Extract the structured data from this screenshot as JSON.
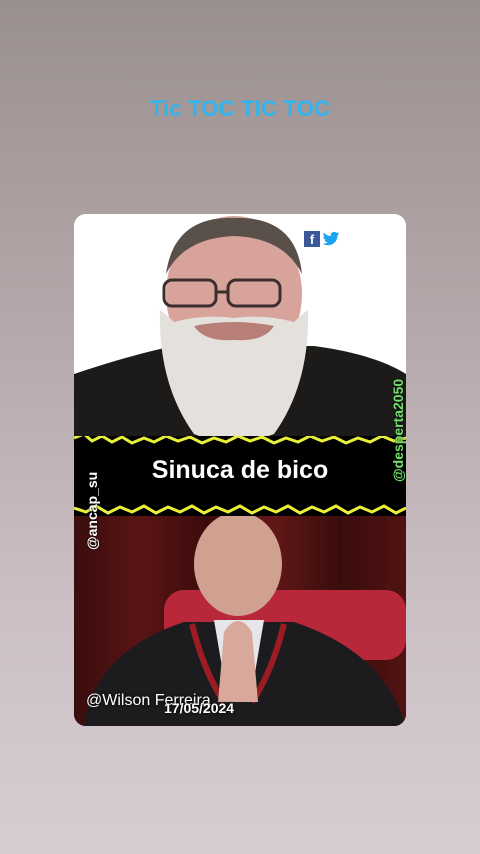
{
  "story": {
    "title": "Tic TOC TIC TOC"
  },
  "card": {
    "band_title": "Sinuca de bico",
    "handle_left": "@ancap_su",
    "handle_right": "@desperta2050",
    "handle_bottom": "@Wilson Ferreira",
    "date": "17/05/2024",
    "social_icons": [
      "facebook-icon",
      "twitter-icon"
    ]
  },
  "colors": {
    "title": "#2fb6f0",
    "band_edge": "#e8f03a",
    "handle_right": "#6fe06a"
  }
}
